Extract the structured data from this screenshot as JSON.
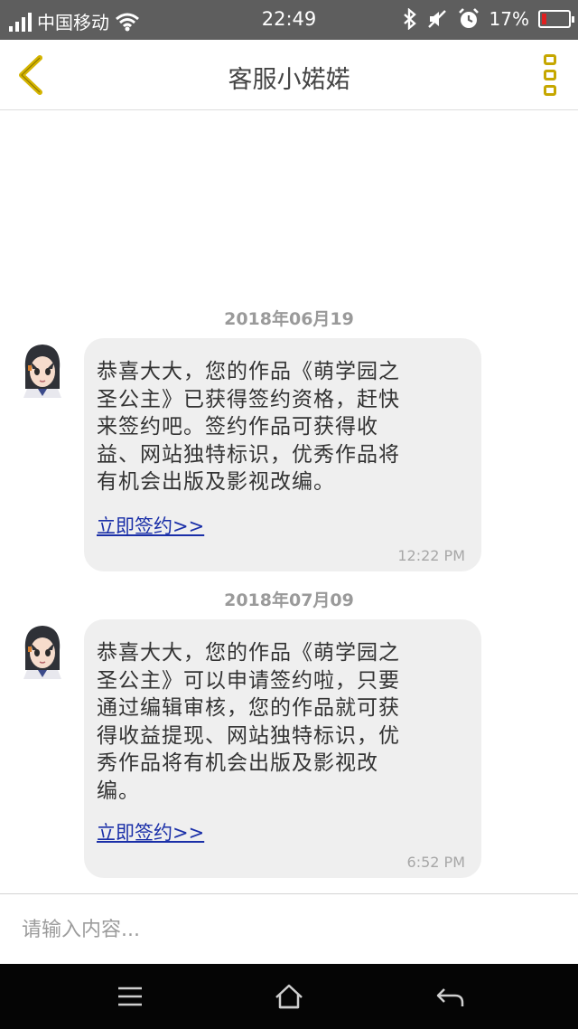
{
  "status_bar": {
    "carrier": "中国移动",
    "time": "22:49",
    "battery": "17%",
    "battery_level": 0.17,
    "icons": [
      "signal-icon",
      "wifi-icon",
      "bluetooth-icon",
      "mute-icon",
      "alarm-icon",
      "battery-icon"
    ]
  },
  "header": {
    "title": "客服小婼婼",
    "back_icon": "chevron-left-icon",
    "menu_icon": "more-vertical-icon",
    "accent": "#c6a700"
  },
  "messages": [
    {
      "date": "2018年06月19",
      "text": "恭喜大大，您的作品《萌学园之\n圣公主》已获得签约资格，赶快\n来签约吧。签约作品可获得收\n益、网站独特标识，优秀作品将\n有机会出版及影视改编。",
      "link": "立即签约>>",
      "time": "12:22 PM"
    },
    {
      "date": "2018年07月09",
      "text": "恭喜大大，您的作品《萌学园之\n圣公主》可以申请签约啦，只要\n通过编辑审核，您的作品就可获\n得收益提现、网站独特标识，优\n秀作品将有机会出版及影视改\n编。",
      "link": "立即签约>>",
      "time": "6:52 PM"
    }
  ],
  "input": {
    "placeholder": "请输入内容..."
  },
  "nav": {
    "icons": [
      "menu-icon",
      "home-icon",
      "back-icon"
    ]
  }
}
